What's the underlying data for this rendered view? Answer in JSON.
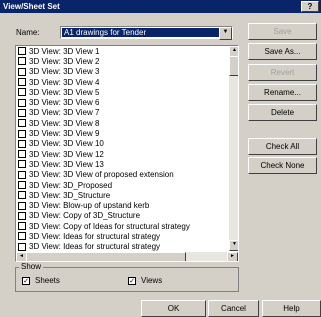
{
  "window": {
    "title": "View/Sheet Set",
    "help_label": "?"
  },
  "name_field": {
    "label": "Name:",
    "value": "A1 drawings for Tender",
    "arrow": "▼"
  },
  "list": {
    "items": [
      "3D View: 3D View 1",
      "3D View: 3D View 2",
      "3D View: 3D View 3",
      "3D View: 3D View 4",
      "3D View: 3D View 5",
      "3D View: 3D View 6",
      "3D View: 3D View 7",
      "3D View: 3D View 8",
      "3D View: 3D View 9",
      "3D View: 3D View 10",
      "3D View: 3D View 12",
      "3D View: 3D View 13",
      "3D View: 3D View of proposed extension",
      "3D View: 3D_Proposed",
      "3D View: 3D_Structure",
      "3D View: Blow-up of upstand kerb",
      "3D View: Copy of 3D_Structure",
      "3D View: Copy of Ideas for structural strategy",
      "3D View: Ideas for structural strategy",
      "3D View: Ideas for structural strategy"
    ],
    "scroll_up": "▲",
    "scroll_down": "▼",
    "scroll_left": "◄",
    "scroll_right": "►"
  },
  "buttons": {
    "save": "Save",
    "save_as": "Save As...",
    "revert": "Revert",
    "rename": "Rename...",
    "delete": "Delete",
    "check_all": "Check All",
    "check_none": "Check None",
    "ok": "OK",
    "cancel": "Cancel",
    "help": "Help"
  },
  "show_group": {
    "title": "Show",
    "sheets": {
      "label": "Sheets",
      "checked": true,
      "mark": "✓"
    },
    "views": {
      "label": "Views",
      "checked": true,
      "mark": "✓"
    }
  }
}
